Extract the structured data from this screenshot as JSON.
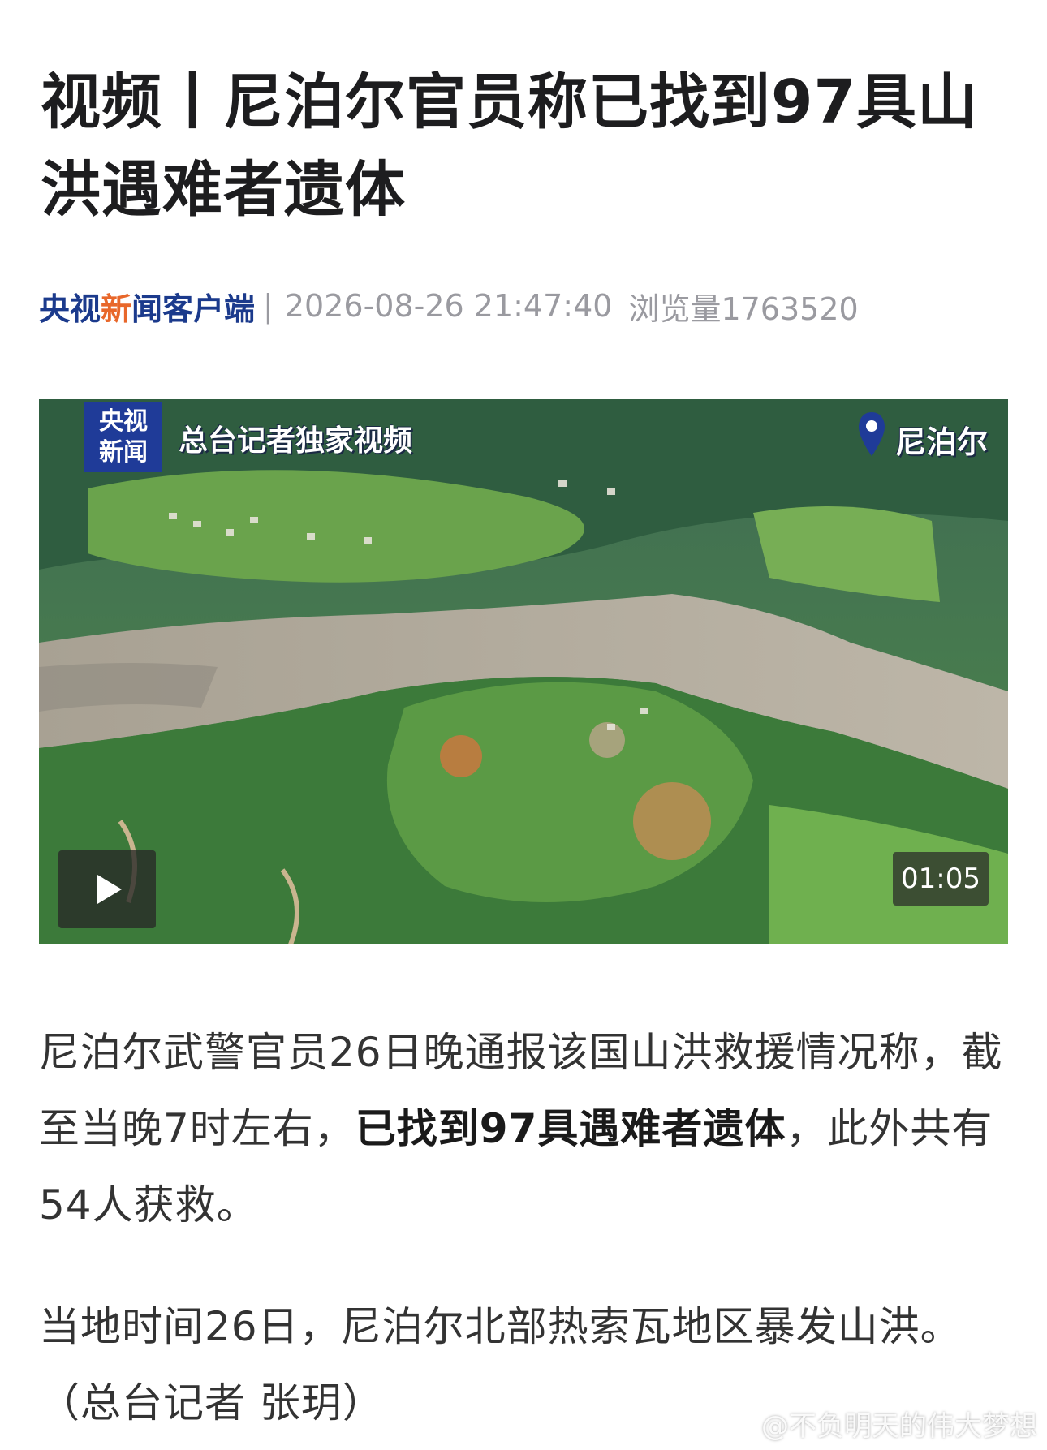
{
  "article": {
    "title": "视频丨尼泊尔官员称已找到97具山洪遇难者遗体",
    "source_part1": "央视",
    "source_accent": "新",
    "source_part2": "闻客户端",
    "separator": "|",
    "timestamp": "2026-08-26 21:47:40",
    "views": "浏览量1763520"
  },
  "video": {
    "logo_line1": "央视",
    "logo_line2": "新闻",
    "banner": "总台记者独家视频",
    "location": "尼泊尔",
    "duration": "01:05",
    "icons": {
      "play": "play-icon",
      "location": "location-pin-icon"
    }
  },
  "body": {
    "p1_a": "尼泊尔武警官员26日晚通报该国山洪救援情况称，截至当晚7时左右，",
    "p1_bold": "已找到97具遇难者遗体",
    "p1_b": "，此外共有54人获救。",
    "p2": "当地时间26日，尼泊尔北部热索瓦地区暴发山洪。（总台记者 张玥）"
  },
  "watermark": {
    "text": "@不负明天的伟大梦想",
    "icon": "weibo-icon"
  },
  "colors": {
    "brand_blue": "#1b3a8c",
    "accent_orange": "#e8672a",
    "meta_gray": "#9a9aa0"
  }
}
